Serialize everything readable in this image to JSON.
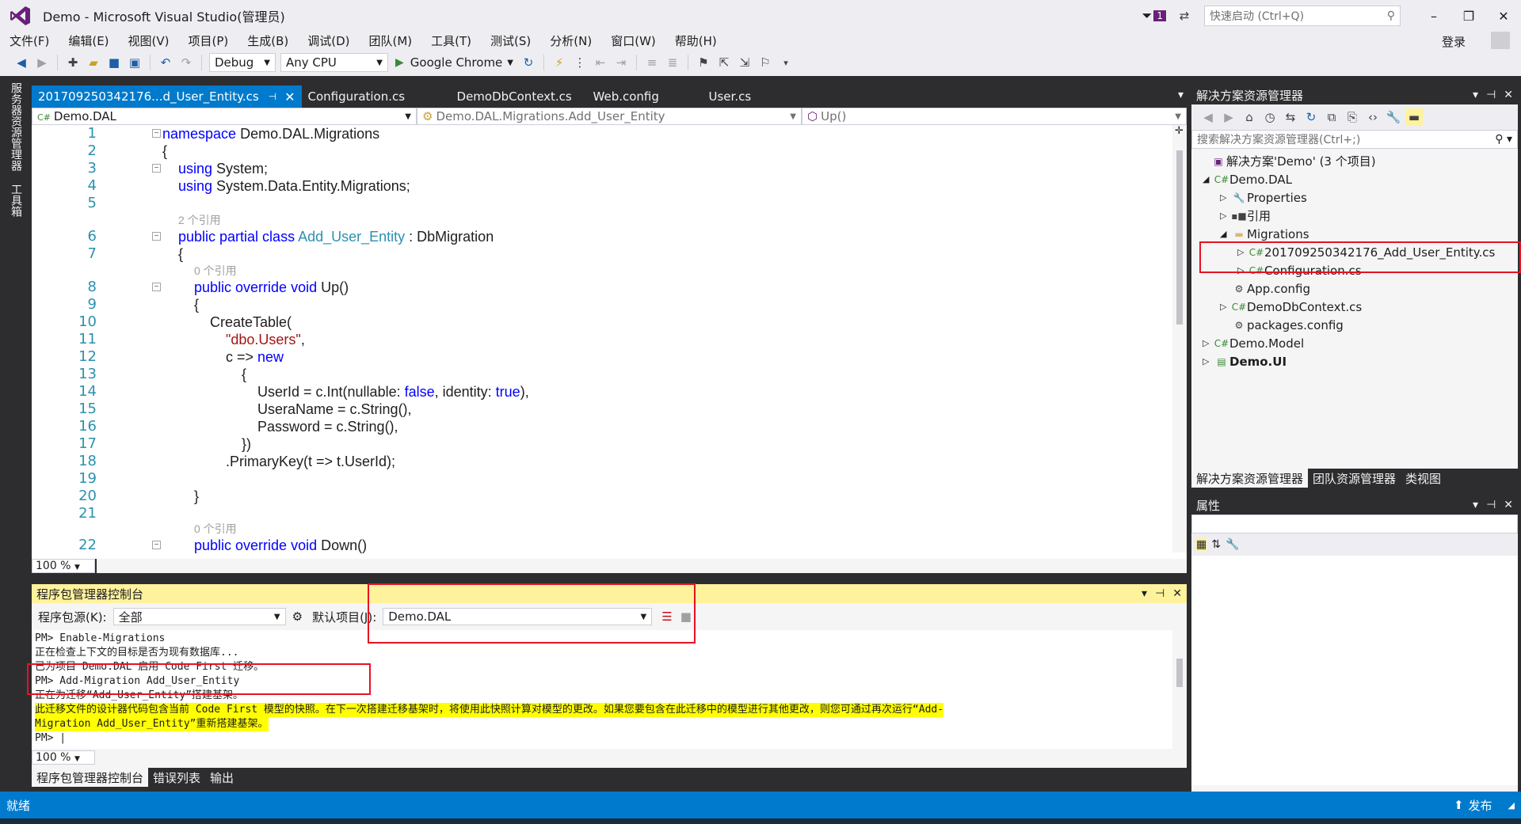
{
  "window": {
    "title": "Demo - Microsoft Visual Studio(管理员)",
    "notif_count": "1",
    "quick_launch_placeholder": "快速启动 (Ctrl+Q)",
    "login": "登录"
  },
  "menu": [
    "文件(F)",
    "编辑(E)",
    "视图(V)",
    "项目(P)",
    "生成(B)",
    "调试(D)",
    "团队(M)",
    "工具(T)",
    "测试(S)",
    "分析(N)",
    "窗口(W)",
    "帮助(H)"
  ],
  "toolbar": {
    "config": "Debug",
    "platform": "Any CPU",
    "run_target": "Google Chrome"
  },
  "left_strip": [
    "服务器资源管理器",
    "工具箱"
  ],
  "editor_tabs": [
    {
      "label": "201709250342176...d_User_Entity.cs",
      "active": true
    },
    {
      "label": "Configuration.cs"
    },
    {
      "label": "DemoDbContext.cs"
    },
    {
      "label": "Web.config"
    },
    {
      "label": "User.cs"
    }
  ],
  "navbar": {
    "project": "Demo.DAL",
    "type": "Demo.DAL.Migrations.Add_User_Entity",
    "member": "Up()"
  },
  "code": {
    "line_numbers": [
      "1",
      "2",
      "3",
      "4",
      "5",
      "6",
      "7",
      "8",
      "9",
      "10",
      "11",
      "12",
      "13",
      "14",
      "15",
      "16",
      "17",
      "18",
      "19",
      "20",
      "21",
      "22"
    ],
    "refs": {
      "class_refs": "2 个引用",
      "up_refs": "0 个引用",
      "down_refs": "0 个引用"
    },
    "lines": {
      "l1_kw": "namespace",
      "l1_rest": " Demo.DAL.Migrations",
      "l2": "{",
      "l3_kw": "using",
      "l3_rest": " System;",
      "l4_kw": "using",
      "l4_rest": " System.Data.Entity.Migrations;",
      "l6_kw": "public partial class",
      "l6_type": " Add_User_Entity",
      "l6_rest": " : DbMigration",
      "l7": "{",
      "l8_kw": "public override void",
      "l8_rest": " Up()",
      "l9": "{",
      "l10": "CreateTable(",
      "l11_str": "\"dbo.Users\"",
      "l11_rest": ",",
      "l12_a": "c => ",
      "l12_kw": "new",
      "l13": "{",
      "l14_a": "UserId = c.Int(nullable: ",
      "l14_kw1": "false",
      "l14_b": ", identity: ",
      "l14_kw2": "true",
      "l14_c": "),",
      "l15": "UseraName = c.String(),",
      "l16": "Password = c.String(),",
      "l17": "})",
      "l18": ".PrimaryKey(t => t.UserId);",
      "l20": "}",
      "l22_kw": "public override void",
      "l22_rest": " Down()"
    }
  },
  "editor_zoom": "100 %",
  "pmc": {
    "title": "程序包管理器控制台",
    "source_label": "程序包源(K):",
    "source_value": "全部",
    "default_project_label": "默认项目(J):",
    "default_project_value": "Demo.DAL",
    "output": [
      "PM> Enable-Migrations",
      "正在检查上下文的目标是否为现有数据库...",
      "已为项目 Demo.DAL 启用 Code First 迁移。",
      "PM> Add-Migration Add_User_Entity",
      "正在为迁移“Add_User_Entity”搭建基架。",
      "此迁移文件的设计器代码包含当前 Code First 模型的快照。在下一次搭建迁移基架时，将使用此快照计算对模型的更改。如果您要包含在此迁移中的模型进行其他更改，则您可通过再次运行“Add-",
      "Migration Add_User_Entity”重新搭建基架。",
      "PM> |"
    ],
    "zoom": "100 %",
    "tabs": [
      "程序包管理器控制台",
      "错误列表",
      "输出"
    ]
  },
  "solution_explorer": {
    "title": "解决方案资源管理器",
    "search_placeholder": "搜索解决方案资源管理器(Ctrl+;)",
    "tree": [
      {
        "label": "解决方案'Demo' (3 个项目)",
        "icon": "solution-icon"
      },
      {
        "label": "Demo.DAL",
        "icon": "csproj-icon"
      },
      {
        "label": "Properties",
        "icon": "wrench-icon"
      },
      {
        "label": "引用",
        "icon": "references-icon"
      },
      {
        "label": "Migrations",
        "icon": "folder-icon"
      },
      {
        "label": "201709250342176_Add_User_Entity.cs",
        "icon": "csharp-file-icon"
      },
      {
        "label": "Configuration.cs",
        "icon": "csharp-file-icon"
      },
      {
        "label": "App.config",
        "icon": "config-icon"
      },
      {
        "label": "DemoDbContext.cs",
        "icon": "csharp-file-icon"
      },
      {
        "label": "packages.config",
        "icon": "config-icon"
      },
      {
        "label": "Demo.Model",
        "icon": "csproj-icon"
      },
      {
        "label": "Demo.UI",
        "icon": "webproj-icon"
      }
    ],
    "tabs": [
      "解决方案资源管理器",
      "团队资源管理器",
      "类视图"
    ]
  },
  "properties": {
    "title": "属性"
  },
  "status": {
    "left": "就绪",
    "right": "发布"
  },
  "colors": {
    "accent": "#007acc",
    "vs_purple": "#68217a",
    "annotation_red": "#e81123",
    "keyword": "#0000ff",
    "type": "#2b91af",
    "string": "#a31515"
  }
}
